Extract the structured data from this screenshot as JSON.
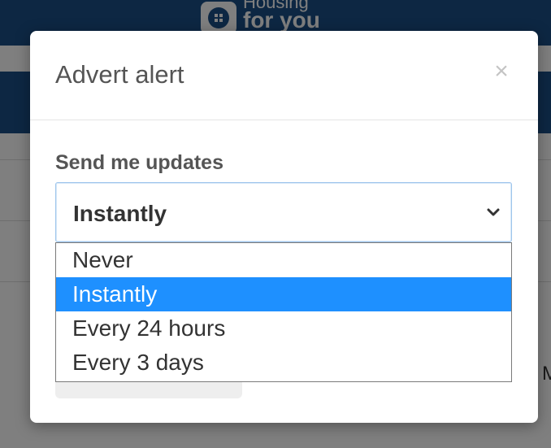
{
  "background": {
    "logo_line1": "Housing",
    "logo_line2": "for you",
    "glimpse_text": "M"
  },
  "modal": {
    "title": "Advert alert",
    "close_label": "×",
    "field_label": "Send me updates",
    "selected_value": "Instantly",
    "options": [
      {
        "label": "Never",
        "selected": false
      },
      {
        "label": "Instantly",
        "selected": true
      },
      {
        "label": "Every 24 hours",
        "selected": false
      },
      {
        "label": "Every 3 days",
        "selected": false
      }
    ]
  },
  "colors": {
    "brand_blue": "#1b4f86",
    "highlight": "#1e90ff"
  }
}
